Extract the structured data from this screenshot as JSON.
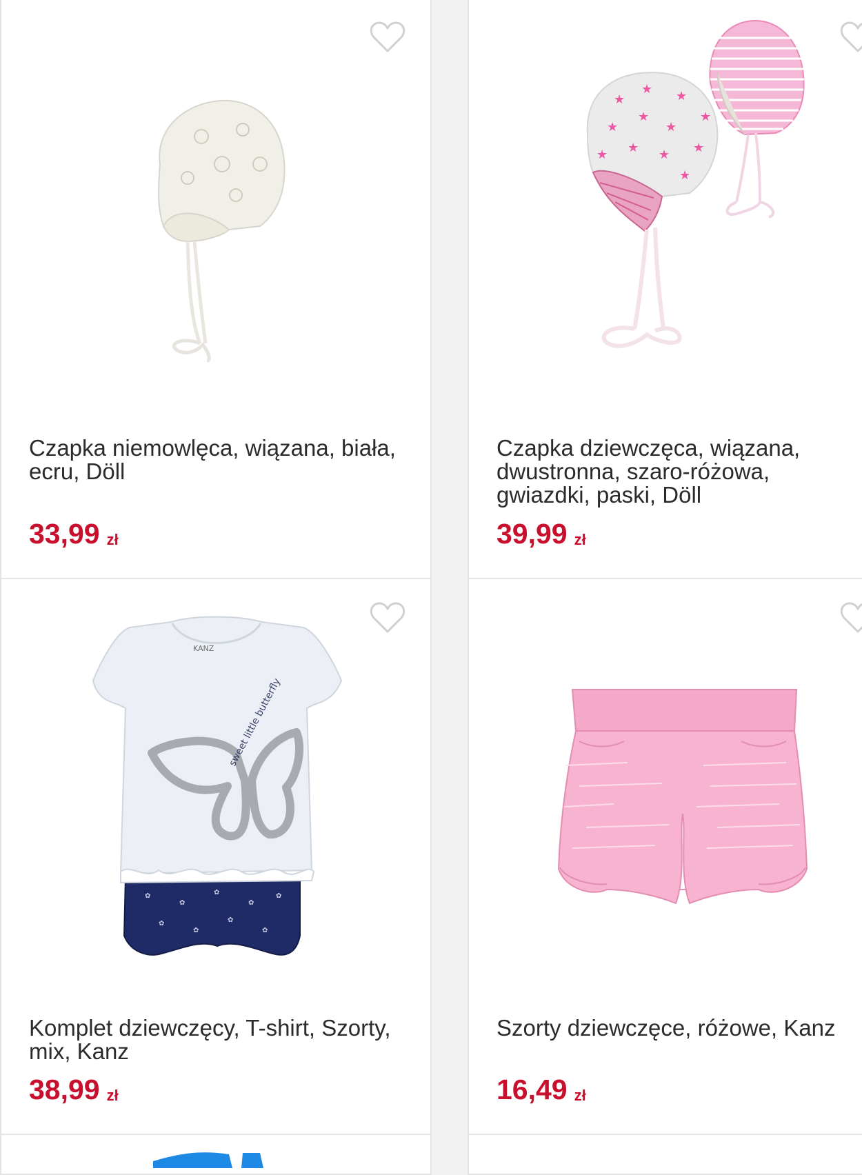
{
  "colors": {
    "price": "#c8102e",
    "border": "#e4e4e4",
    "heart_outline": "#d0d0d0"
  },
  "products": [
    {
      "title": "Czapka niemowlęca, wiązana, biała, ecru, Döll",
      "price": "33,99",
      "currency": "zł",
      "image": "white-baby-bonnet",
      "icon": "heart-outline-icon"
    },
    {
      "title": "Czapka dziewczęca, wiązana, dwustronna, szaro-różowa, gwiazdki, paski, Döll",
      "price": "39,99",
      "currency": "zł",
      "image": "grey-pink-star-bonnet",
      "icon": "heart-outline-icon"
    },
    {
      "title": "Komplet dziewczęcy, T-shirt, Szorty, mix, Kanz",
      "price": "38,99",
      "currency": "zł",
      "image": "tshirt-shorts-set",
      "icon": "heart-outline-icon",
      "image_texts": {
        "tshirt_label": "KANZ",
        "tshirt_print": "sweet little butterfly"
      }
    },
    {
      "title": "Szorty dziewczęce, różowe, Kanz",
      "price": "16,49",
      "currency": "zł",
      "image": "pink-shorts",
      "icon": "heart-outline-icon"
    }
  ]
}
